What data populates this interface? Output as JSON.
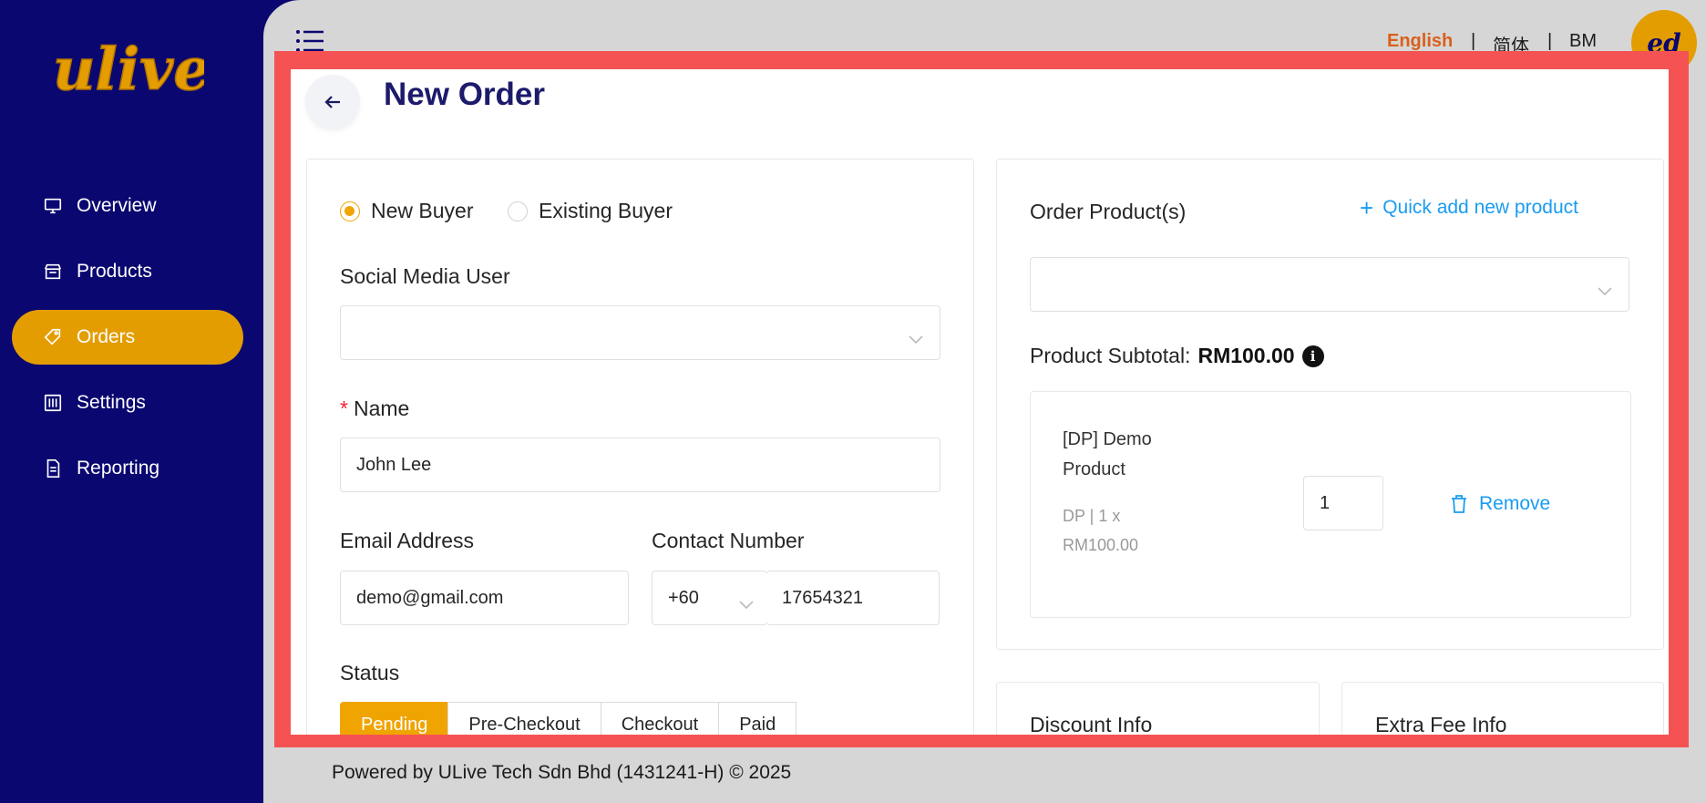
{
  "brand": {
    "logo_text": "ulive",
    "logo_color": "#e39d00"
  },
  "sidebar": {
    "items": [
      {
        "label": "Overview",
        "icon": "monitor-icon",
        "active": false
      },
      {
        "label": "Products",
        "icon": "store-icon",
        "active": false
      },
      {
        "label": "Orders",
        "icon": "tag-icon",
        "active": true
      },
      {
        "label": "Settings",
        "icon": "sliders-icon",
        "active": false
      },
      {
        "label": "Reporting",
        "icon": "document-icon",
        "active": false
      }
    ]
  },
  "header": {
    "languages": [
      "English",
      "简体",
      "BM"
    ],
    "active_language": "English",
    "separator": "|",
    "avatar_initials": "ed"
  },
  "page": {
    "title": "New Order"
  },
  "buyer": {
    "radio_new": "New Buyer",
    "radio_existing": "Existing Buyer",
    "selected": "New Buyer",
    "social_label": "Social Media User",
    "social_value": "",
    "name_required": "*",
    "name_label": "Name",
    "name_value": "John Lee",
    "email_label": "Email Address",
    "email_value": "demo@gmail.com",
    "contact_label": "Contact Number",
    "country_code": "+60",
    "phone_value": "17654321",
    "status_label": "Status",
    "statuses": [
      "Pending",
      "Pre-Checkout",
      "Checkout",
      "Paid"
    ],
    "status_selected": "Pending"
  },
  "products": {
    "label": "Order Product(s)",
    "quick_add": "Quick add new product",
    "select_value": "",
    "subtotal_label": "Product Subtotal:",
    "subtotal_value": "RM100.00",
    "items": [
      {
        "name": "[DP] Demo Product",
        "meta_line1": "DP | 1 x",
        "meta_line2": "RM100.00",
        "qty": "1",
        "remove": "Remove"
      }
    ]
  },
  "discount": {
    "title": "Discount Info"
  },
  "extra_fee": {
    "title": "Extra Fee Info"
  },
  "footer": {
    "text": "Powered by ULive Tech Sdn Bhd (1431241-H) © 2025"
  },
  "colors": {
    "sidebar": "#0a0770",
    "accent": "#e39d00",
    "highlight_frame": "#f55353",
    "link": "#1a9cf0"
  }
}
